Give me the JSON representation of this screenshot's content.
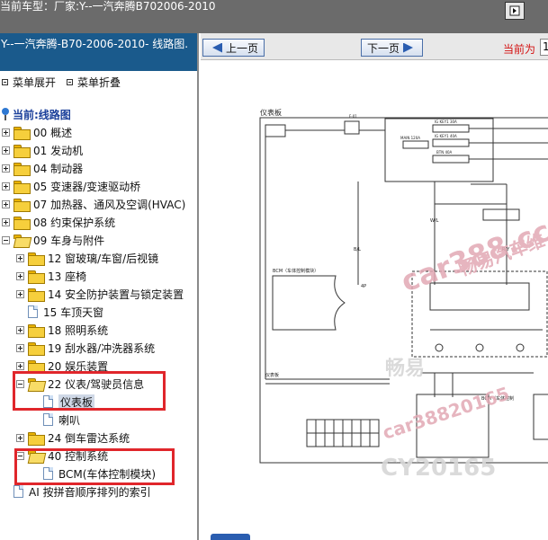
{
  "window": {
    "title": "当前车型：厂家:Y--一汽奔腾B702006-2010"
  },
  "left_panel": {
    "header": "Y--一汽奔腾-B70-2006-2010- 线路图.",
    "menu_expand": "菜单展开",
    "menu_collapse": "菜单折叠",
    "current_label": "当前:线路图",
    "tree": [
      {
        "label": "00 概述"
      },
      {
        "label": "01 发动机"
      },
      {
        "label": "04 制动器"
      },
      {
        "label": "05 变速器/变速驱动桥"
      },
      {
        "label": "07 加热器、通风及空调(HVAC)"
      },
      {
        "label": "08 约束保护系统"
      },
      {
        "label": "09 车身与附件"
      },
      {
        "label": "12 窗玻璃/车窗/后视镜"
      },
      {
        "label": "13 座椅"
      },
      {
        "label": "14 安全防护装置与锁定装置"
      },
      {
        "label": "15 车顶天窗"
      },
      {
        "label": "18 照明系统"
      },
      {
        "label": "19 刮水器/冲洗器系统"
      },
      {
        "label": "20 娱乐装置"
      },
      {
        "label": "22 仪表/驾驶员信息"
      },
      {
        "label": "仪表板"
      },
      {
        "label": "喇叭"
      },
      {
        "label": "24 倒车雷达系统"
      },
      {
        "label": "40 控制系统"
      },
      {
        "label": "BCM(车体控制模块)"
      },
      {
        "label": "AI 按拼音顺序排列的索引"
      }
    ]
  },
  "right_panel": {
    "prev_page": "上一页",
    "next_page": "下一页",
    "page_status": "当前为",
    "page_value": "1"
  },
  "diagram": {
    "title": "仪表板",
    "labels": {
      "fuse": "F-01",
      "ig_key1_30a": "IG KEY1 30A",
      "ig_key1_40a": "IG KEY1 40A",
      "main_120a": "MAIN 120A",
      "btn_40a": "BTN 40A",
      "bcm": "BCM（车体控制模块）",
      "bcm_right": "BCM（车体控制",
      "wire_wl": "W/L",
      "wire_bl": "B/L",
      "wire_ry": "R/Y",
      "conn_4p": "4P",
      "unit": "仪表板"
    }
  },
  "watermarks": {
    "site": "car388.cc",
    "brand": "畅易汽车维",
    "brand2": "畅易",
    "cy": "CY20165",
    "phone_partial": "car38820165"
  },
  "colors": {
    "topbar": "#6b6b6b",
    "left_header": "#1a5a8c",
    "highlight_box": "#e0262b",
    "page_status": "#d41010",
    "watermark_pink": "#e2a9b4"
  }
}
